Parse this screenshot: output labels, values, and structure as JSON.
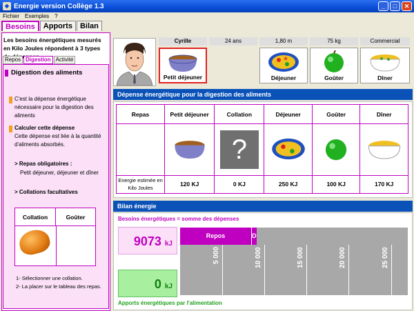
{
  "window": {
    "title": "Energie version Collège 1.3"
  },
  "menu": [
    "Fichier",
    "Exemples",
    "?"
  ],
  "main_tabs": [
    {
      "label": "Besoins",
      "active": true
    },
    {
      "label": "Apports"
    },
    {
      "label": "Bilan"
    }
  ],
  "left": {
    "intro": "Les besoins énergétiques mesurés en Kilo Joules répondent à 3 types de dépenses.",
    "subtabs": [
      {
        "label": "Repos"
      },
      {
        "label": "Digestion",
        "active": true
      },
      {
        "label": "Activité"
      }
    ],
    "title": "Digestion des aliments",
    "p1": "C'est la dépense énergétique nécessaire pour la digestion des aliments",
    "p2_title": "Calculer cette dépense",
    "p2": "Cette dépense est liée à la quantité d'aliments absorbés.",
    "p3_title": "> Repas obligatoires :",
    "p3": "Petit déjeuner, déjeuner et dîner",
    "p4_title": "> Collations facultatives",
    "table_headers": [
      "Collation",
      "Goûter"
    ],
    "instructions": [
      "1-  Sélectionner une collation.",
      "2-  La placer sur le tableau des repas."
    ]
  },
  "person": {
    "name": "Cyrille",
    "age": "24 ans",
    "height": "1,80 m",
    "weight": "75 kg",
    "job": "Commercial"
  },
  "meals": [
    "Petit déjeuner",
    "Déjeuner",
    "Goûter",
    "Dîner"
  ],
  "digestion": {
    "header": "Dépense énergétique pour la digestion des aliments",
    "columns": [
      "Repas",
      "Petit déjeuner",
      "Collation",
      "Déjeuner",
      "Goûter",
      "Dîner"
    ],
    "row_label": "Energie estimée en Kilo Joules",
    "values": [
      "120 KJ",
      "0 KJ",
      "250 KJ",
      "100 KJ",
      "170 KJ"
    ],
    "placeholder": "?"
  },
  "bilan": {
    "header": "Bilan énergie",
    "besoins_label": "Besoins énergétiques = somme des dépenses",
    "besoins_value": "9073",
    "unit": "kJ",
    "apports_label": "Apports énergétiques par l'alimentation",
    "apports_value": "0",
    "segments": [
      {
        "label": "Repos",
        "value": 8433
      },
      {
        "label": "Dig",
        "value": 640
      }
    ],
    "ticks": [
      "5 000",
      "10 000",
      "15 000",
      "20 000",
      "25 000"
    ],
    "scale_max": 27000
  },
  "colors": {
    "accent": "#c000c0",
    "header_blue": "#0a52b8",
    "green": "#20a020"
  }
}
